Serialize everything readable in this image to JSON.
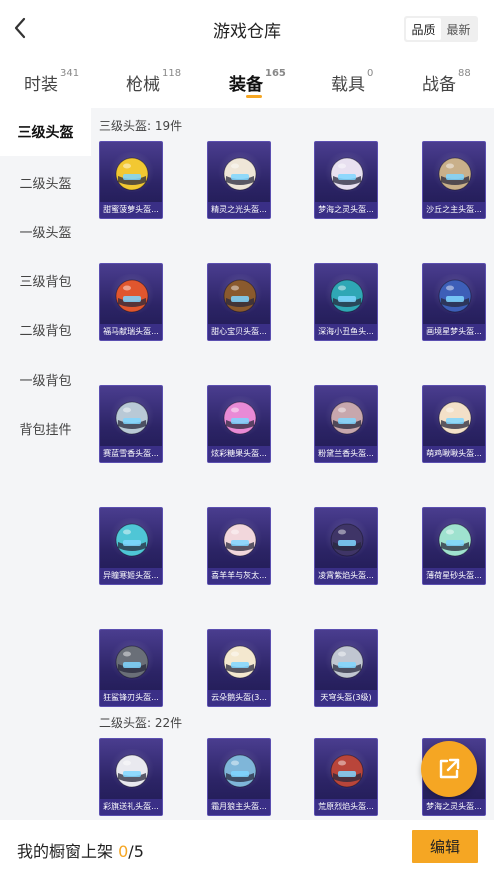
{
  "header": {
    "title": "游戏仓库",
    "sort_options": [
      "品质",
      "最新"
    ],
    "active_sort": 0
  },
  "tabs": [
    {
      "label": "时装",
      "count": "341"
    },
    {
      "label": "枪械",
      "count": "118"
    },
    {
      "label": "装备",
      "count": "165"
    },
    {
      "label": "载具",
      "count": "0"
    },
    {
      "label": "战备",
      "count": "88"
    }
  ],
  "sidebar": {
    "items": [
      "三级头盔",
      "二级头盔",
      "一级头盔",
      "三级背包",
      "二级背包",
      "一级背包",
      "背包挂件"
    ]
  },
  "sections": [
    {
      "title": "三级头盔: 19件",
      "items": [
        {
          "name": "甜蜜菠萝头盔...",
          "color": "#f2c832"
        },
        {
          "name": "精灵之光头盔...",
          "color": "#efe6d8"
        },
        {
          "name": "梦海之灵头盔...",
          "color": "#e8e0f0"
        },
        {
          "name": "沙丘之主头盔...",
          "color": "#c9b08a"
        },
        {
          "name": "福马献瑞头盔...",
          "color": "#e0562e"
        },
        {
          "name": "甜心宝贝头盔...",
          "color": "#8a5a2e"
        },
        {
          "name": "深海小丑鱼头...",
          "color": "#2fa7b5"
        },
        {
          "name": "画境星梦头盔...",
          "color": "#3d5fb8"
        },
        {
          "name": "赛蓝雪香头盔...",
          "color": "#b9c9d6"
        },
        {
          "name": "炫彩糖果头盔...",
          "color": "#e98ad6"
        },
        {
          "name": "粉黛兰香头盔...",
          "color": "#c7a7ad"
        },
        {
          "name": "萌鸡啾啾头盔...",
          "color": "#f3e0c8"
        },
        {
          "name": "异瞳寒姬头盔...",
          "color": "#4fc6d6"
        },
        {
          "name": "喜羊羊与灰太...",
          "color": "#f2d7dc"
        },
        {
          "name": "凌霄紫焰头盔...",
          "color": "#3f3567"
        },
        {
          "name": "薄荷星砂头盔...",
          "color": "#9fe2cf"
        },
        {
          "name": "狂鲨锋刃头盔...",
          "color": "#6a6f78"
        },
        {
          "name": "云朵鹅头盔(3...",
          "color": "#f4e8cf"
        },
        {
          "name": "天穹头盔(3级)",
          "color": "#c0c6d1"
        }
      ]
    },
    {
      "title": "二级头盔: 22件",
      "items": [
        {
          "name": "彩旗送礼头盔...",
          "color": "#e9e9ef"
        },
        {
          "name": "霜月狼主头盔...",
          "color": "#7fb6d9"
        },
        {
          "name": "荒原烈焰头盔...",
          "color": "#b9453a"
        },
        {
          "name": "梦海之灵头盔...",
          "color": "#cfc7ea"
        }
      ]
    }
  ],
  "bottom": {
    "showcase_label": "我的橱窗上架",
    "showcase_count": "0",
    "showcase_total": "/5",
    "edit_label": "编辑"
  },
  "colors": {
    "accent": "#f5a623",
    "card_bg": "#2c2466",
    "card_label_bg": "#3a2f86"
  }
}
